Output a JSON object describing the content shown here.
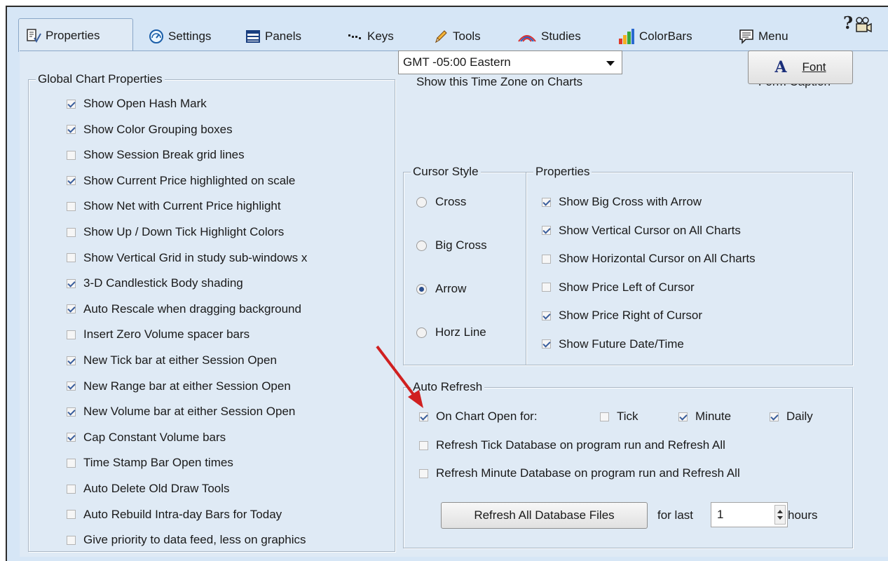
{
  "tabs": [
    {
      "label": "Properties",
      "icon": "properties-icon",
      "active": true
    },
    {
      "label": "Settings",
      "icon": "settings-icon"
    },
    {
      "label": "Panels",
      "icon": "panels-icon"
    },
    {
      "label": "Keys",
      "icon": "keys-icon"
    },
    {
      "label": "Tools",
      "icon": "pencil-icon"
    },
    {
      "label": "Studies",
      "icon": "studies-icon"
    },
    {
      "label": "ColorBars",
      "icon": "colorbars-icon"
    },
    {
      "label": "Menu",
      "icon": "menu-icon"
    }
  ],
  "help_label": "?",
  "global": {
    "title": "Global Chart Properties",
    "items": [
      {
        "label": "Show Open Hash Mark",
        "checked": true
      },
      {
        "label": "Show Color Grouping boxes",
        "checked": true
      },
      {
        "label": "Show Session Break grid lines",
        "checked": false
      },
      {
        "label": "Show Current Price highlighted on scale",
        "checked": true
      },
      {
        "label": "Show Net with Current Price highlight",
        "checked": false
      },
      {
        "label": "Show Up / Down Tick Highlight Colors",
        "checked": false
      },
      {
        "label": "Show Vertical Grid in study sub-windows x",
        "checked": false
      },
      {
        "label": "3-D Candlestick Body shading",
        "checked": true
      },
      {
        "label": "Auto Rescale when dragging background",
        "checked": true
      },
      {
        "label": "Insert Zero Volume spacer bars",
        "checked": false
      },
      {
        "label": "New Tick bar at either Session Open",
        "checked": true
      },
      {
        "label": "New Range bar at either Session Open",
        "checked": true
      },
      {
        "label": "New Volume bar at either Session Open",
        "checked": true
      },
      {
        "label": "Cap Constant Volume bars",
        "checked": true
      },
      {
        "label": "Time Stamp Bar Open times",
        "checked": false
      },
      {
        "label": "Auto Delete Old Draw Tools",
        "checked": false
      },
      {
        "label": "Auto Rebuild Intra-day Bars for Today",
        "checked": false
      },
      {
        "label": "Give priority to data feed, less on graphics",
        "checked": false
      }
    ]
  },
  "timezone": {
    "label": "Show this Time Zone on Charts",
    "value": "GMT -05:00  Eastern"
  },
  "form_caption": {
    "label": "Form Caption",
    "font_glyph": "A",
    "font_button": "Font"
  },
  "cursor_style": {
    "title": "Cursor Style",
    "options": [
      {
        "label": "Cross",
        "selected": false
      },
      {
        "label": "Big Cross",
        "selected": false
      },
      {
        "label": "Arrow",
        "selected": true
      },
      {
        "label": "Horz Line",
        "selected": false
      }
    ]
  },
  "cursor_props": {
    "title": "Properties",
    "items": [
      {
        "label": "Show Big Cross with Arrow",
        "checked": true
      },
      {
        "label": "Show Vertical Cursor on All Charts",
        "checked": true
      },
      {
        "label": "Show Horizontal Cursor on All Charts",
        "checked": false
      },
      {
        "label": "Show Price Left of Cursor",
        "checked": false
      },
      {
        "label": "Show Price Right of Cursor",
        "checked": true
      },
      {
        "label": "Show Future Date/Time",
        "checked": true
      }
    ]
  },
  "auto_refresh": {
    "title": "Auto Refresh",
    "on_open": {
      "label": "On Chart Open for:",
      "checked": true
    },
    "tick": {
      "label": "Tick",
      "checked": false
    },
    "minute": {
      "label": "Minute",
      "checked": true
    },
    "daily": {
      "label": "Daily",
      "checked": true
    },
    "refresh_tick": {
      "label": "Refresh Tick Database on program run and Refresh All",
      "checked": false
    },
    "refresh_minute": {
      "label": "Refresh Minute Database on program run and Refresh All",
      "checked": false
    },
    "refresh_button": "Refresh All Database Files",
    "for_last": "for last",
    "hours_value": "1",
    "hours": "hours"
  },
  "colors": {
    "panel_bg": "#dfeaf5",
    "tab_strip_bg": "#d6e6f6",
    "annotation_arrow": "#d02020"
  }
}
